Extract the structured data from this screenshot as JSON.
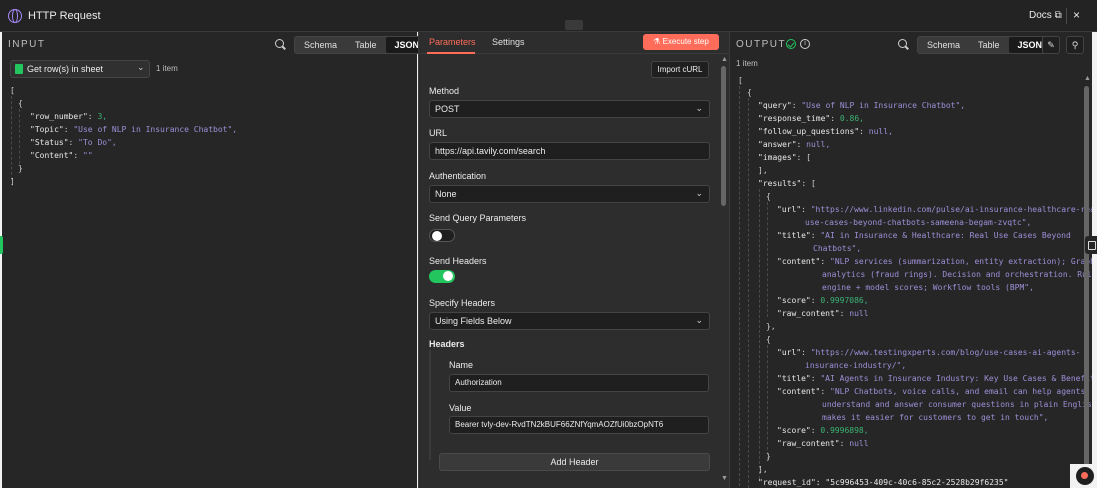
{
  "header": {
    "title": "HTTP Request",
    "docs_label": "Docs",
    "close_label": "×"
  },
  "input_panel": {
    "label": "INPUT",
    "tabs": [
      "Schema",
      "Table",
      "JSON"
    ],
    "active_tab": "JSON",
    "sheet_select": "Get row(s) in sheet",
    "item_count": "1 item",
    "json": {
      "row_number_key": "\"row_number\"",
      "row_number_val": "3,",
      "topic_key": "\"Topic\"",
      "topic_val": "\"Use of NLP in Insurance Chatbot\",",
      "status_key": "\"Status\"",
      "status_val": "\"To Do\",",
      "content_key": "\"Content\"",
      "content_val": "\"\""
    }
  },
  "middle_panel": {
    "tabs": {
      "parameters": "Parameters",
      "settings": "Settings"
    },
    "execute_label": "Execute step",
    "import_curl": "Import cURL",
    "method_label": "Method",
    "method_value": "POST",
    "url_label": "URL",
    "url_value": "https://api.tavily.com/search",
    "auth_label": "Authentication",
    "auth_value": "None",
    "send_query_label": "Send Query Parameters",
    "send_query_on": false,
    "send_headers_label": "Send Headers",
    "send_headers_on": true,
    "specify_headers_label": "Specify Headers",
    "specify_headers_value": "Using Fields Below",
    "headers_label": "Headers",
    "name_label": "Name",
    "name_value": "Authorization",
    "value_label": "Value",
    "value_value": "Bearer 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",
    "add_header": "Add Header"
  },
  "output_panel": {
    "label": "OUTPUT",
    "item_count": "1 item",
    "tabs": [
      "Schema",
      "Table",
      "JSON"
    ],
    "active_tab": "JSON",
    "json": {
      "query_key": "\"query\"",
      "query_val": "\"Use of NLP in Insurance Chatbot\",",
      "response_time_key": "\"response_time\"",
      "response_time_val": "0.86,",
      "follow_up_key": "\"follow_up_questions\"",
      "follow_up_val": "null,",
      "answer_key": "\"answer\"",
      "answer_val": "null,",
      "images_key": "\"images\"",
      "results_key": "\"results\"",
      "r1_url_key": "\"url\"",
      "r1_url_val_1": "\"https://www.linkedin.com/pulse/ai-insurance-healthcare-real-",
      "r1_url_val_2": "use-cases-beyond-chatbots-sameena-begam-zvqtc\",",
      "r1_title_key": "\"title\"",
      "r1_title_val_1": "\"AI in Insurance & Healthcare: Real Use Cases Beyond",
      "r1_title_val_2": "Chatbots\",",
      "r1_content_key": "\"content\"",
      "r1_content_val_1": "\"NLP services (summarization, entity extraction); Graph",
      "r1_content_val_2": "analytics (fraud rings). Decision and orchestration. Rules",
      "r1_content_val_3": "engine + model scores; Workflow tools (BPM\",",
      "r1_score_key": "\"score\"",
      "r1_score_val": "0.9997086,",
      "r1_raw_key": "\"raw_content\"",
      "r1_raw_val": "null",
      "r2_url_key": "\"url\"",
      "r2_url_val_1": "\"https://www.testingxperts.com/blog/use-cases-ai-agents-",
      "r2_url_val_2": "insurance-industry/\",",
      "r2_title_key": "\"title\"",
      "r2_title_val": "\"AI Agents in Insurance Industry: Key Use Cases & Benefits\",",
      "r2_content_key": "\"content\"",
      "r2_content_val_1": "\"NLP Chatbots, voice calls, and email can help agents",
      "r2_content_val_2": "understand and answer consumer questions in plain English. It",
      "r2_content_val_3": "makes it easier for customers to get in touch\",",
      "r2_score_key": "\"score\"",
      "r2_score_val": "0.9996898,",
      "r2_raw_key": "\"raw_content\"",
      "r2_raw_val": "null",
      "request_id_partial": "\"request_id\": \"5c996453-409c-40c6-85c2-2528b29f6235\""
    }
  },
  "colors": {
    "accent": "#ff6d5a",
    "success": "#22c55e",
    "string": "#9f8fd8",
    "number": "#3bb273"
  },
  "icons": [
    "globe-icon",
    "external-link-icon",
    "close-icon",
    "search-icon",
    "sheet-icon",
    "chevron-down-icon",
    "flask-icon",
    "check-circle-icon",
    "info-icon",
    "pencil-icon",
    "pin-icon",
    "chat-icon"
  ]
}
